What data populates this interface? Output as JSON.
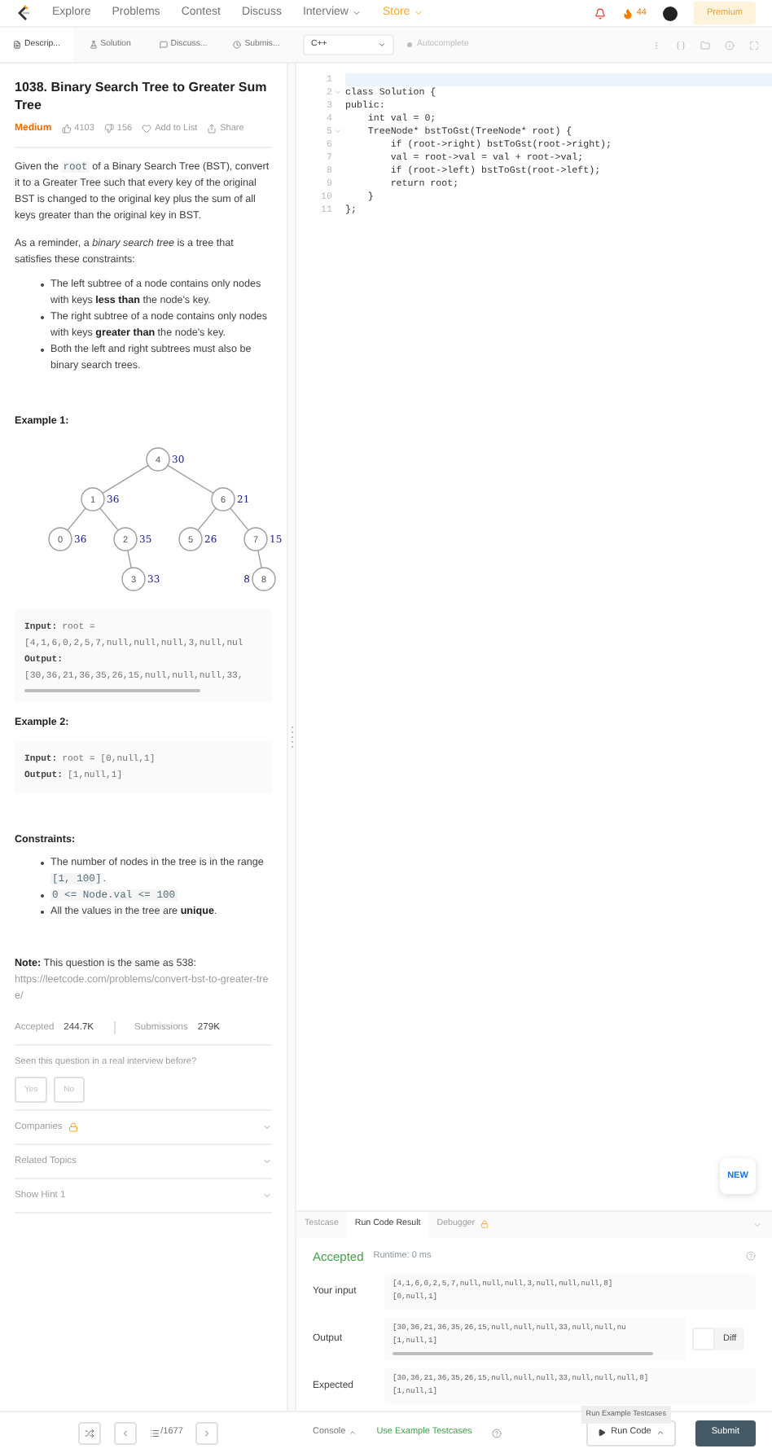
{
  "nav": {
    "items": [
      {
        "label": "Explore",
        "dropdown": false,
        "highlight": false
      },
      {
        "label": "Problems",
        "dropdown": false,
        "highlight": false
      },
      {
        "label": "Contest",
        "dropdown": false,
        "highlight": false
      },
      {
        "label": "Discuss",
        "dropdown": false,
        "highlight": false
      },
      {
        "label": "Interview",
        "dropdown": true,
        "highlight": false
      },
      {
        "label": "Store",
        "dropdown": true,
        "highlight": true
      }
    ],
    "streak": "44",
    "premium": "Premium"
  },
  "tabs": [
    {
      "label": "Descrip...",
      "selected": true
    },
    {
      "label": "Solution",
      "selected": false
    },
    {
      "label": "Discuss...",
      "selected": false
    },
    {
      "label": "Submis...",
      "selected": false
    }
  ],
  "language": "C++",
  "autocomplete": {
    "label": "Autocomplete",
    "on": false
  },
  "problem": {
    "title": "1038. Binary Search Tree to Greater Sum Tree",
    "difficulty": "Medium",
    "likes": "4103",
    "dislikes": "156",
    "add_to_list": "Add to List",
    "share": "Share",
    "paragraphs": [
      [
        {
          "kind": "text",
          "text": "Given the "
        },
        {
          "kind": "code",
          "text": "root"
        },
        {
          "kind": "text",
          "text": " of a Binary Search Tree (BST), convert it to a Greater Tree such that every key of the original BST is changed to the original key plus the sum of all keys greater than the original key in BST."
        }
      ],
      [
        {
          "kind": "text",
          "text": "As a reminder, a "
        },
        {
          "kind": "italic",
          "text": "binary search tree"
        },
        {
          "kind": "text",
          "text": " is a tree that satisfies these constraints:"
        }
      ]
    ],
    "bullets": [
      [
        {
          "kind": "text",
          "text": "The left subtree of a node contains only nodes with keys "
        },
        {
          "kind": "bold",
          "text": "less than"
        },
        {
          "kind": "text",
          "text": " the node's key."
        }
      ],
      [
        {
          "kind": "text",
          "text": "The right subtree of a node contains only nodes with keys "
        },
        {
          "kind": "bold",
          "text": "greater than"
        },
        {
          "kind": "text",
          "text": " the node's key."
        }
      ],
      [
        {
          "kind": "text",
          "text": "Both the left and right subtrees must also be binary search trees."
        }
      ]
    ],
    "example1": {
      "title": "Example 1:",
      "tree": {
        "value": "4",
        "sum": "30",
        "left": {
          "value": "1",
          "sum": "36",
          "left": {
            "value": "0",
            "sum": "36"
          },
          "right": {
            "value": "2",
            "sum": "35",
            "right": {
              "value": "3",
              "sum": "33"
            }
          }
        },
        "right": {
          "value": "6",
          "sum": "21",
          "left": {
            "value": "5",
            "sum": "26"
          },
          "right": {
            "value": "7",
            "sum": "15",
            "right": {
              "value": "8",
              "sum": "8"
            }
          }
        }
      },
      "lines": [
        {
          "label": "Input:",
          "text": "root ="
        },
        {
          "text": "[4,1,6,0,2,5,7,null,null,null,3,null,nul"
        },
        {
          "label": "Output:"
        },
        {
          "text": "[30,36,21,36,35,26,15,null,null,null,33,"
        }
      ]
    },
    "example2": {
      "title": "Example 2:",
      "lines": [
        {
          "label": "Input:",
          "text": "root = [0,null,1]"
        },
        {
          "label": "Output:",
          "text": "[1,null,1]"
        }
      ]
    },
    "constraints_title": "Constraints:",
    "constraints": [
      [
        {
          "kind": "text",
          "text": "The number of nodes in the tree is in the range "
        },
        {
          "kind": "code",
          "text": "[1, 100]"
        },
        {
          "kind": "text",
          "text": "."
        }
      ],
      [
        {
          "kind": "code",
          "text": "0 <= Node.val <= 100"
        }
      ],
      [
        {
          "kind": "text",
          "text": "All the values in the tree are "
        },
        {
          "kind": "bold",
          "text": "unique"
        },
        {
          "kind": "text",
          "text": "."
        }
      ]
    ],
    "note_label": "Note:",
    "note": "This question is the same as 538:",
    "note_link": "https://leetcode.com/problems/convert-bst-to-greater-tree/",
    "accepted_label": "Accepted",
    "accepted": "244.7K",
    "submissions_label": "Submissions",
    "submissions": "279K",
    "seen_question": "Seen this question in a real interview before?",
    "answers": [
      "Yes",
      "No"
    ],
    "sections": [
      {
        "label": "Companies",
        "locked": true
      },
      {
        "label": "Related Topics",
        "locked": false
      },
      {
        "label": "Show Hint 1",
        "locked": false
      }
    ]
  },
  "code": [
    {
      "num": "1",
      "fold": false,
      "active": true
    },
    {
      "num": "2",
      "fold": true,
      "active": false,
      "text": "class Solution {"
    },
    {
      "num": "3",
      "fold": false,
      "active": false,
      "text": "public:"
    },
    {
      "num": "4",
      "fold": false,
      "active": false,
      "text": "    int val = 0;"
    },
    {
      "num": "5",
      "fold": true,
      "active": false,
      "text": "    TreeNode* bstToGst(TreeNode* root) {"
    },
    {
      "num": "6",
      "fold": false,
      "active": false,
      "text": "        if (root->right) bstToGst(root->right);"
    },
    {
      "num": "7",
      "fold": false,
      "active": false,
      "text": "        val = root->val = val + root->val;"
    },
    {
      "num": "8",
      "fold": false,
      "active": false,
      "text": "        if (root->left) bstToGst(root->left);"
    },
    {
      "num": "9",
      "fold": false,
      "active": false,
      "text": "        return root;"
    },
    {
      "num": "10",
      "fold": false,
      "active": false,
      "text": "    }"
    },
    {
      "num": "11",
      "fold": false,
      "active": false,
      "text": "};"
    }
  ],
  "new_badge": "NEW",
  "result_tabs": [
    {
      "label": "Testcase",
      "locked": false,
      "selected": false
    },
    {
      "label": "Run Code Result",
      "locked": false,
      "selected": true
    },
    {
      "label": "Debugger",
      "locked": true,
      "selected": false
    }
  ],
  "result": {
    "status": "Accepted",
    "runtime": "Runtime: 0 ms",
    "rows": [
      {
        "label": "Your input",
        "lines": [
          "[4,1,6,0,2,5,7,null,null,null,3,null,null,null,8]",
          "[0,null,1]"
        ],
        "scroll": false
      },
      {
        "label": "Output",
        "lines": [
          "[30,36,21,36,35,26,15,null,null,null,33,null,null,nu",
          "[1,null,1]"
        ],
        "scroll": true
      },
      {
        "label": "Expected",
        "lines": [
          "[30,36,21,36,35,26,15,null,null,null,33,null,null,null,8]",
          "[1,null,1]"
        ],
        "scroll": false
      }
    ],
    "diff": {
      "label": "Diff",
      "on": false
    }
  },
  "tooltip": "Run Example Testcases",
  "pager": {
    "current": "/1677"
  },
  "bottom": {
    "console": "Console",
    "use_example": "Use Example Testcases",
    "run": "Run Code",
    "submit": "Submit"
  }
}
